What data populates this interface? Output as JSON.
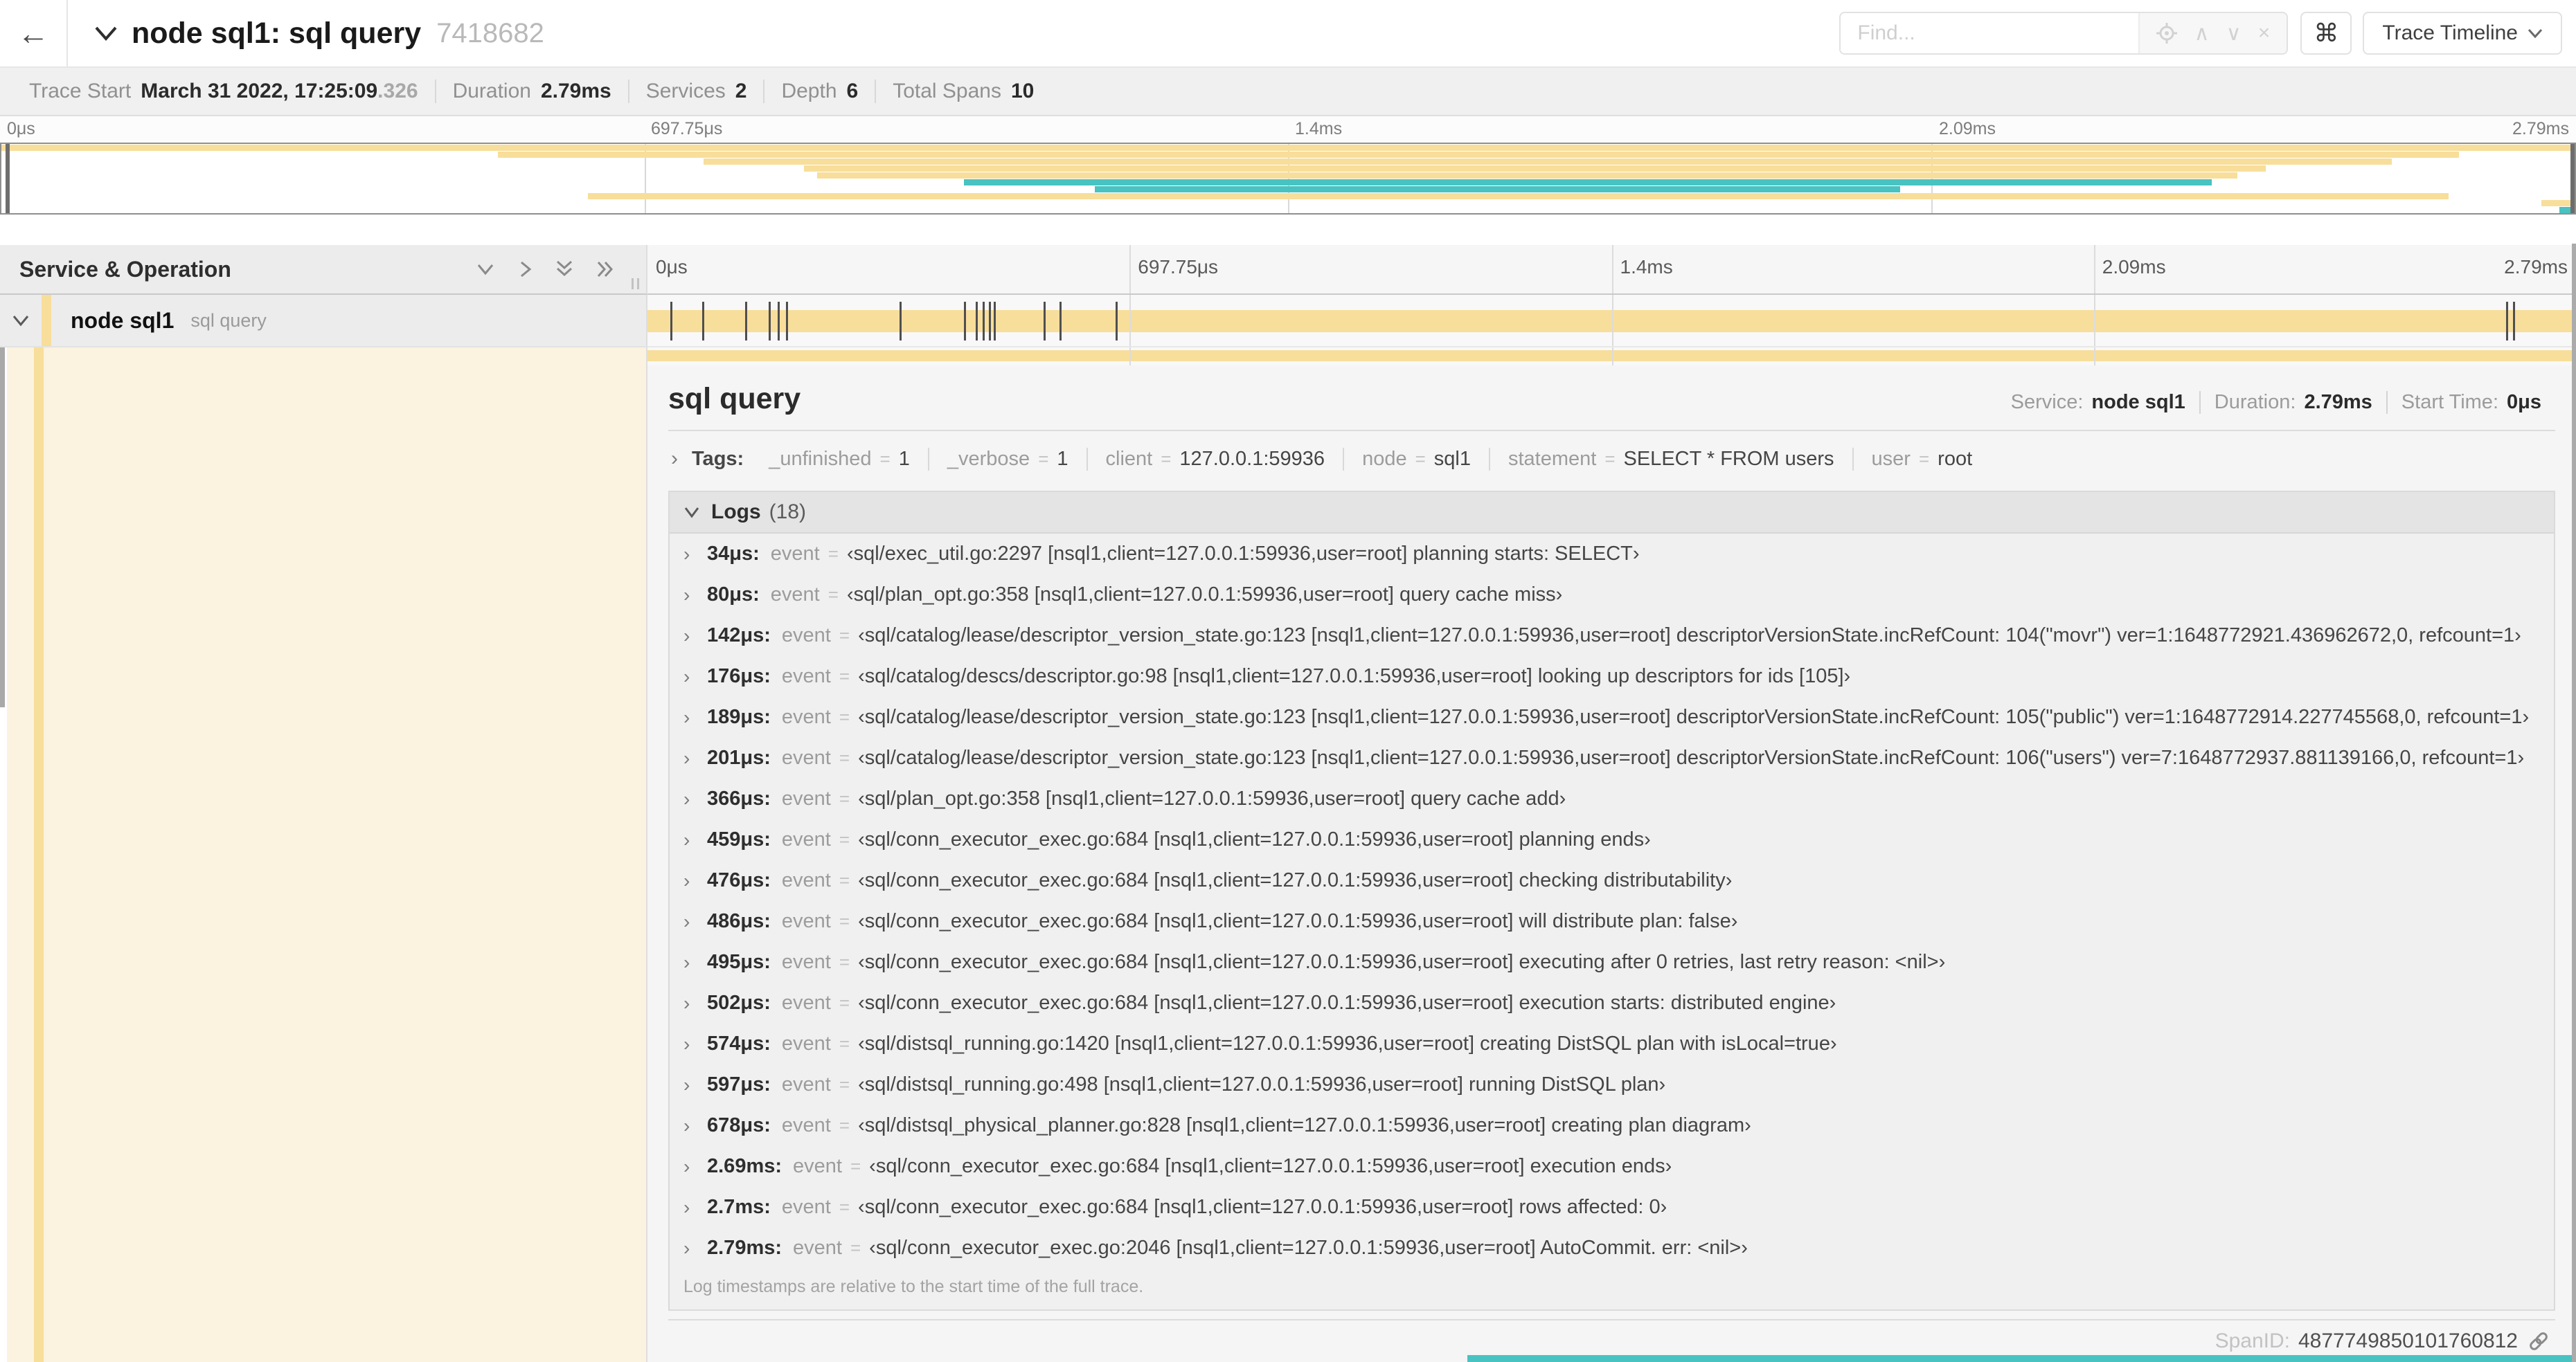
{
  "colors": {
    "tan": "#F8DE9B",
    "teal": "#49C2C2",
    "cream": "#FBF2DF"
  },
  "header": {
    "back_icon": "←",
    "title": "node sql1: sql query",
    "trace_id": "7418682",
    "find_placeholder": "Find...",
    "shortcut_button": "⌘",
    "view_button_label": "Trace Timeline",
    "find_next_icon": "∧",
    "find_prev_icon": "∨",
    "find_clear_icon": "×"
  },
  "trace_stats": [
    {
      "label": "Trace Start",
      "value": "March 31 2022, 17:25:09",
      "dim": ".326"
    },
    {
      "label": "Duration",
      "value": "2.79ms",
      "dim": ""
    },
    {
      "label": "Services",
      "value": "2",
      "dim": ""
    },
    {
      "label": "Depth",
      "value": "6",
      "dim": ""
    },
    {
      "label": "Total Spans",
      "value": "10",
      "dim": ""
    }
  ],
  "timeline": {
    "ticks": [
      "0μs",
      "697.75μs",
      "1.4ms",
      "2.09ms",
      "2.79ms"
    ],
    "tick_positions_pct": [
      0,
      25,
      50,
      75,
      100
    ],
    "grid_pct": [
      25,
      50,
      75
    ],
    "minimap_spans": [
      {
        "color": "tan",
        "start": 0,
        "end": 100
      },
      {
        "color": "tan",
        "start": 19.3,
        "end": 95.5
      },
      {
        "color": "tan",
        "start": 27.3,
        "end": 92.9
      },
      {
        "color": "tan",
        "start": 31.2,
        "end": 88.0
      },
      {
        "color": "tan",
        "start": 31.7,
        "end": 86.9
      },
      {
        "color": "teal",
        "start": 37.4,
        "end": 85.9
      },
      {
        "color": "teal",
        "start": 42.5,
        "end": 73.8
      },
      {
        "color": "tan",
        "start": 22.8,
        "end": 95.1
      },
      {
        "color": "tan",
        "start": 98.7,
        "end": 100
      },
      {
        "color": "teal",
        "start": 99.4,
        "end": 100
      }
    ],
    "log_marks_pct": [
      1.22,
      2.87,
      5.09,
      6.31,
      6.77,
      7.2,
      13.12,
      16.45,
      17.06,
      17.42,
      17.74,
      17.99,
      20.57,
      21.4,
      24.3,
      96.42,
      96.77,
      99.85
    ],
    "bottom_sliver": {
      "color": "teal",
      "start_pct": 42.5
    }
  },
  "span_table": {
    "header": "Service & Operation",
    "row": {
      "service": "node sql1",
      "operation": "sql query"
    }
  },
  "detail": {
    "title": "sql query",
    "meta": [
      {
        "label": "Service:",
        "value": "node sql1"
      },
      {
        "label": "Duration:",
        "value": "2.79ms"
      },
      {
        "label": "Start Time:",
        "value": "0μs"
      }
    ],
    "tags_label": "Tags:",
    "tag_eq": "=",
    "tags": [
      {
        "key": "_unfinished",
        "value": "1"
      },
      {
        "key": "_verbose",
        "value": "1"
      },
      {
        "key": "client",
        "value": "127.0.0.1:59936"
      },
      {
        "key": "node",
        "value": "sql1"
      },
      {
        "key": "statement",
        "value": "SELECT * FROM users"
      },
      {
        "key": "user",
        "value": "root"
      }
    ],
    "logs_title": "Logs",
    "logs_count": "(18)",
    "log_key": "event",
    "logs": [
      {
        "t": "34μs:",
        "v": "‹sql/exec_util.go:2297 [nsql1,client=127.0.0.1:59936,user=root] planning starts: SELECT›"
      },
      {
        "t": "80μs:",
        "v": "‹sql/plan_opt.go:358 [nsql1,client=127.0.0.1:59936,user=root] query cache miss›"
      },
      {
        "t": "142μs:",
        "v": "‹sql/catalog/lease/descriptor_version_state.go:123 [nsql1,client=127.0.0.1:59936,user=root] descriptorVersionState.incRefCount: 104(\"movr\") ver=1:1648772921.436962672,0, refcount=1›"
      },
      {
        "t": "176μs:",
        "v": "‹sql/catalog/descs/descriptor.go:98 [nsql1,client=127.0.0.1:59936,user=root] looking up descriptors for ids [105]›"
      },
      {
        "t": "189μs:",
        "v": "‹sql/catalog/lease/descriptor_version_state.go:123 [nsql1,client=127.0.0.1:59936,user=root] descriptorVersionState.incRefCount: 105(\"public\") ver=1:1648772914.227745568,0, refcount=1›"
      },
      {
        "t": "201μs:",
        "v": "‹sql/catalog/lease/descriptor_version_state.go:123 [nsql1,client=127.0.0.1:59936,user=root] descriptorVersionState.incRefCount: 106(\"users\") ver=7:1648772937.881139166,0, refcount=1›"
      },
      {
        "t": "366μs:",
        "v": "‹sql/plan_opt.go:358 [nsql1,client=127.0.0.1:59936,user=root] query cache add›"
      },
      {
        "t": "459μs:",
        "v": "‹sql/conn_executor_exec.go:684 [nsql1,client=127.0.0.1:59936,user=root] planning ends›"
      },
      {
        "t": "476μs:",
        "v": "‹sql/conn_executor_exec.go:684 [nsql1,client=127.0.0.1:59936,user=root] checking distributability›"
      },
      {
        "t": "486μs:",
        "v": "‹sql/conn_executor_exec.go:684 [nsql1,client=127.0.0.1:59936,user=root] will distribute plan: false›"
      },
      {
        "t": "495μs:",
        "v": "‹sql/conn_executor_exec.go:684 [nsql1,client=127.0.0.1:59936,user=root] executing after 0 retries, last retry reason: <nil>›"
      },
      {
        "t": "502μs:",
        "v": "‹sql/conn_executor_exec.go:684 [nsql1,client=127.0.0.1:59936,user=root] execution starts: distributed engine›"
      },
      {
        "t": "574μs:",
        "v": "‹sql/distsql_running.go:1420 [nsql1,client=127.0.0.1:59936,user=root] creating DistSQL plan with isLocal=true›"
      },
      {
        "t": "597μs:",
        "v": "‹sql/distsql_running.go:498 [nsql1,client=127.0.0.1:59936,user=root] running DistSQL plan›"
      },
      {
        "t": "678μs:",
        "v": "‹sql/distsql_physical_planner.go:828 [nsql1,client=127.0.0.1:59936,user=root] creating plan diagram›"
      },
      {
        "t": "2.69ms:",
        "v": "‹sql/conn_executor_exec.go:684 [nsql1,client=127.0.0.1:59936,user=root] execution ends›"
      },
      {
        "t": "2.7ms:",
        "v": "‹sql/conn_executor_exec.go:684 [nsql1,client=127.0.0.1:59936,user=root] rows affected: 0›"
      },
      {
        "t": "2.79ms:",
        "v": "‹sql/conn_executor_exec.go:2046 [nsql1,client=127.0.0.1:59936,user=root] AutoCommit. err: <nil>›"
      }
    ],
    "logs_note": "Log timestamps are relative to the start time of the full trace.",
    "span_id_label": "SpanID:",
    "span_id": "4877749850101760812"
  }
}
